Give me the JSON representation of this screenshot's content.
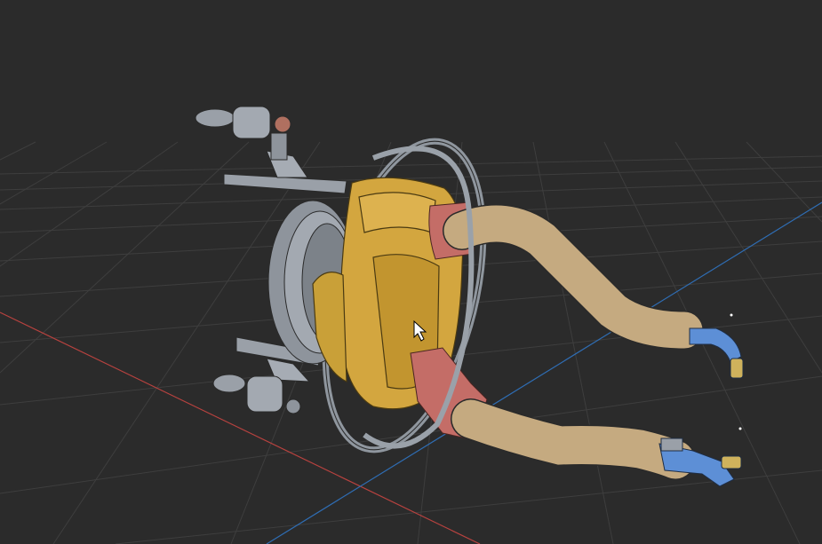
{
  "viewport": {
    "background": "#2b2b2b",
    "grid_color": "#3d3d3d",
    "x_axis_color": "#b8423f",
    "y_axis_color": "#2f6db3"
  },
  "model": {
    "parts": [
      {
        "name": "body-housing",
        "color": "#d3a63f"
      },
      {
        "name": "hose",
        "color": "#c5aa80"
      },
      {
        "name": "connector",
        "color": "#c46d67"
      },
      {
        "name": "metal-hardware",
        "color": "#9aa0a8"
      },
      {
        "name": "fitting",
        "color": "#5d8fd6"
      },
      {
        "name": "nozzle",
        "color": "#cfb25c"
      }
    ]
  },
  "cursor": {
    "icon": "arrow-cursor-icon"
  }
}
